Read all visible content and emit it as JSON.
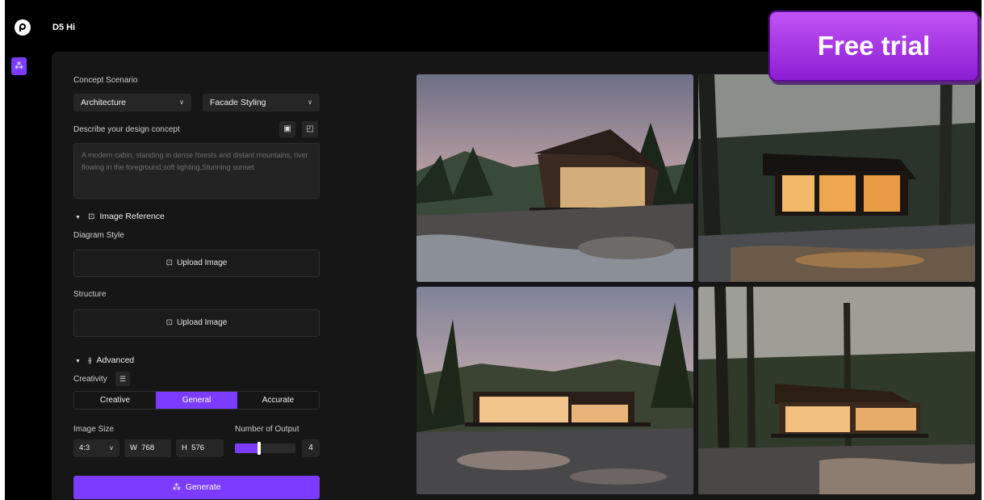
{
  "app": {
    "title": "D5 Hi"
  },
  "sidebar": {
    "tool_icon": "magic-wand-icon"
  },
  "concept": {
    "label": "Concept Scenario",
    "category": "Architecture",
    "style": "Facade Styling",
    "describe_label": "Describe your design concept",
    "prompt": "A modern cabin, standing in dense forests and distant mountains, river flowing in the foreground,soft lighting,Stunning sunset"
  },
  "image_reference": {
    "title": "Image Reference",
    "diagram_style_label": "Diagram Style",
    "structure_label": "Structure",
    "upload_label": "Upload Image"
  },
  "advanced": {
    "title": "Advanced",
    "creativity_label": "Creativity",
    "modes": [
      "Creative",
      "General",
      "Accurate"
    ],
    "active_mode": "General",
    "image_size_label": "Image Size",
    "ratio": "4:3",
    "width_prefix": "W",
    "width": "768",
    "height_prefix": "H",
    "height": "576",
    "output_label": "Number of Output",
    "output_count": "4",
    "output_fraction": 0.4
  },
  "generate": {
    "label": "Generate"
  },
  "results": [
    {
      "name": "result-image-1"
    },
    {
      "name": "result-image-2"
    },
    {
      "name": "result-image-3"
    },
    {
      "name": "result-image-4"
    }
  ],
  "promo": {
    "label": "Free trial"
  },
  "colors": {
    "accent": "#7b3cff",
    "panel": "#161616",
    "badge": "#a833e8"
  }
}
